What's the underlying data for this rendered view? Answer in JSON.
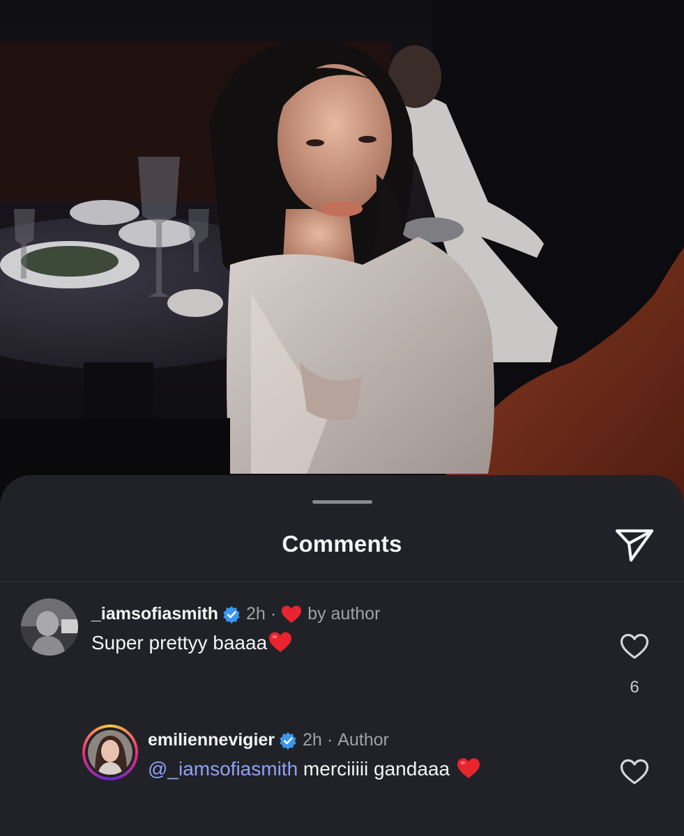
{
  "sheet": {
    "title": "Comments",
    "share_icon": "paper-plane-icon"
  },
  "comments": [
    {
      "username": "_iamsofiasmith",
      "verified": true,
      "time": "2h",
      "separator": "·",
      "liked_by_author": true,
      "liked_label": "by author",
      "text": "Super prettyy baaaa",
      "like_count": "6"
    },
    {
      "username": "emiliennevigier",
      "verified": true,
      "time": "2h",
      "separator": "·",
      "role": "Author",
      "mention": "@_iamsofiasmith",
      "text": " merciiiii gandaaa "
    }
  ],
  "colors": {
    "sheet_bg": "#212227",
    "verified_blue": "#3897f0",
    "heart_red": "#e8242f",
    "mention_blue": "#8ea2f7"
  }
}
